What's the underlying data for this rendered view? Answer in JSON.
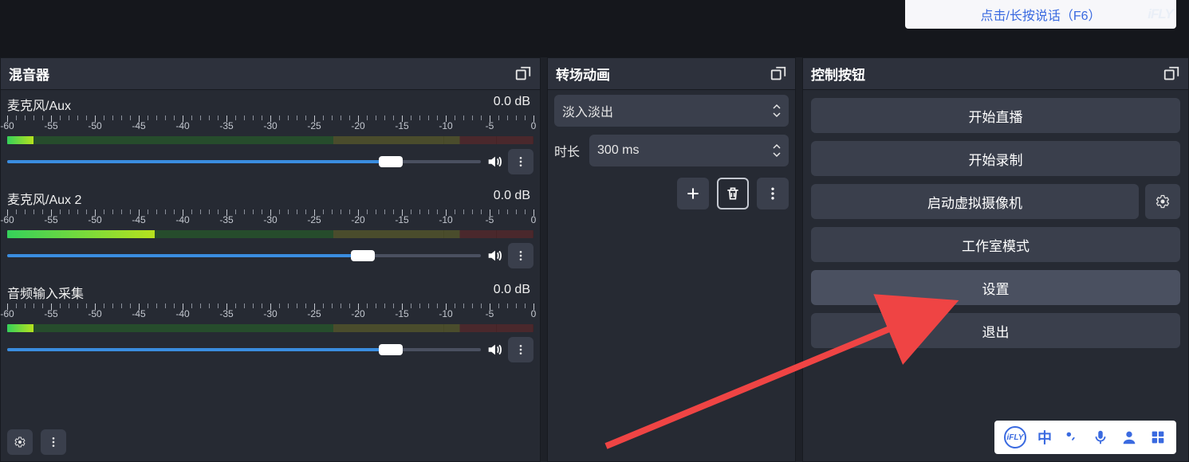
{
  "top_callout": {
    "text": "点击/长按说话（F6）",
    "logo": "iFLY"
  },
  "mixer": {
    "title": "混音器",
    "scale_labels": [
      "-60",
      "-55",
      "-50",
      "-45",
      "-40",
      "-35",
      "-30",
      "-25",
      "-20",
      "-15",
      "-10",
      "-5",
      "0"
    ],
    "channels": [
      {
        "name": "麦克风/Aux",
        "db": "0.0 dB",
        "fill_pct": 81,
        "meter_pct": 5
      },
      {
        "name": "麦克风/Aux 2",
        "db": "0.0 dB",
        "fill_pct": 75,
        "meter_pct": 28
      },
      {
        "name": "音频输入采集",
        "db": "0.0 dB",
        "fill_pct": 81,
        "meter_pct": 5
      }
    ]
  },
  "transition": {
    "title": "转场动画",
    "selected": "淡入淡出",
    "duration_label": "时长",
    "duration_value": "300 ms"
  },
  "controls": {
    "title": "控制按钮",
    "buttons": {
      "stream": "开始直播",
      "record": "开始录制",
      "vcam": "启动虚拟摄像机",
      "studio": "工作室模式",
      "settings": "设置",
      "exit": "退出"
    }
  },
  "ime": {
    "lang": "中"
  }
}
